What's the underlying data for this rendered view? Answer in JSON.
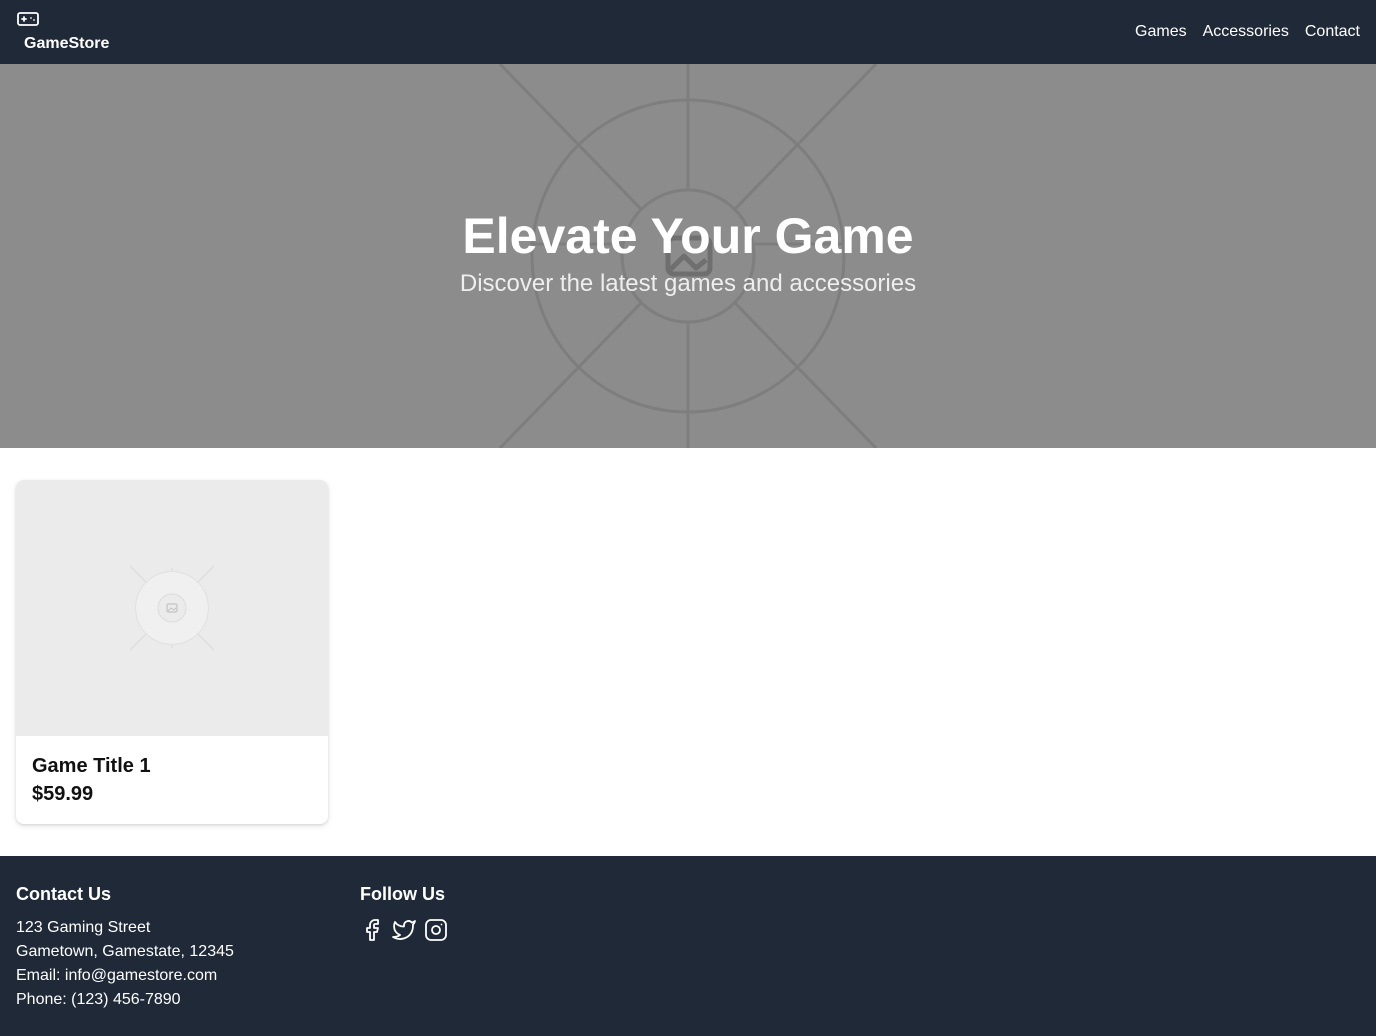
{
  "header": {
    "brand": "GameStore",
    "brand_icon": "gamepad-icon",
    "nav": [
      "Games",
      "Accessories",
      "Contact"
    ]
  },
  "hero": {
    "title": "Elevate Your Game",
    "subtitle": "Discover the latest games and accessories",
    "background_icon": "image-placeholder-icon"
  },
  "products": [
    {
      "title": "Game Title 1",
      "price": "$59.99",
      "image_icon": "image-placeholder-icon"
    }
  ],
  "footer": {
    "contact": {
      "title": "Contact Us",
      "lines": [
        "123 Gaming Street",
        "Gametown, Gamestate, 12345",
        "Email: info@gamestore.com",
        "Phone: (123) 456-7890"
      ]
    },
    "follow": {
      "title": "Follow Us",
      "icons": [
        "facebook-icon",
        "twitter-icon",
        "instagram-icon"
      ]
    }
  },
  "colors": {
    "header_bg": "#1f2937",
    "footer_bg": "#1f2937",
    "hero_bg": "#8c8c8c",
    "card_image_bg": "#ebebeb"
  }
}
